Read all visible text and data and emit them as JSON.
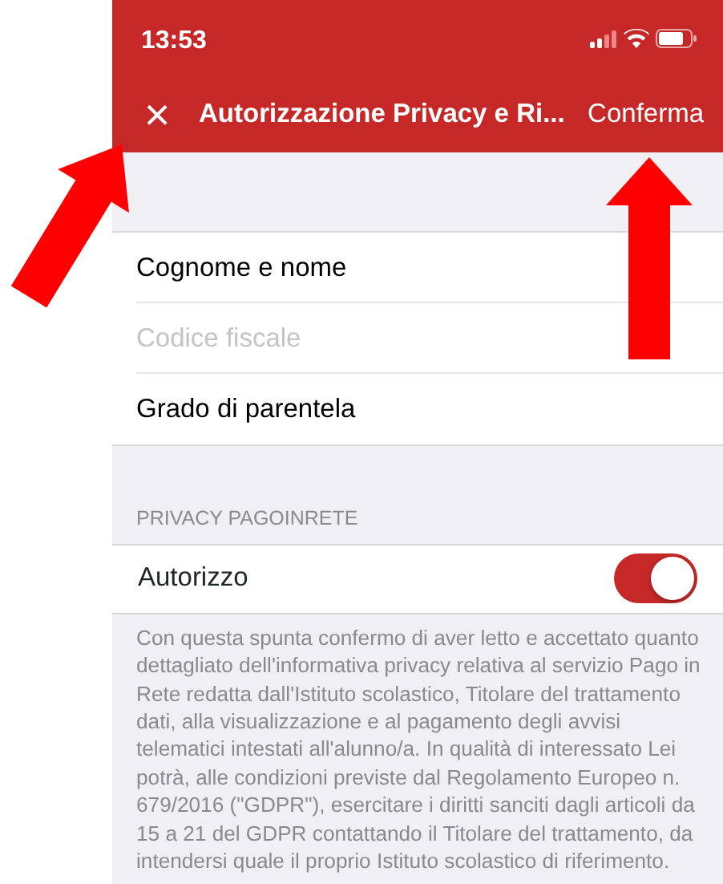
{
  "status_bar": {
    "time": "13:53"
  },
  "nav_bar": {
    "close": "×",
    "title": "Autorizzazione Privacy e Ri...",
    "action": "Conferma"
  },
  "fields": [
    {
      "value": "Cognome e nome"
    },
    {
      "placeholder": "Codice fiscale"
    },
    {
      "value": "Grado di parentela"
    }
  ],
  "section": {
    "header": "PRIVACY PAGOINRETE",
    "toggle": {
      "label": "Autorizzo",
      "on": true
    },
    "footer": "Con questa spunta confermo di aver letto e accettato quanto dettagliato dell'informativa privacy relativa al servizio Pago in Rete redatta dall'Istituto scolastico, Titolare del trattamento dati, alla visualizzazione e al pagamento degli avvisi telematici intestati all'alunno/a. In qualità di interessato Lei potrà, alle condizioni previste dal Regolamento Europeo n. 679/2016 (\"GDPR\"), esercitare i diritti sanciti dagli articoli da 15 a 21 del GDPR contattando il Titolare del trattamento, da intendersi quale il proprio Istituto scolastico di riferimento."
  }
}
